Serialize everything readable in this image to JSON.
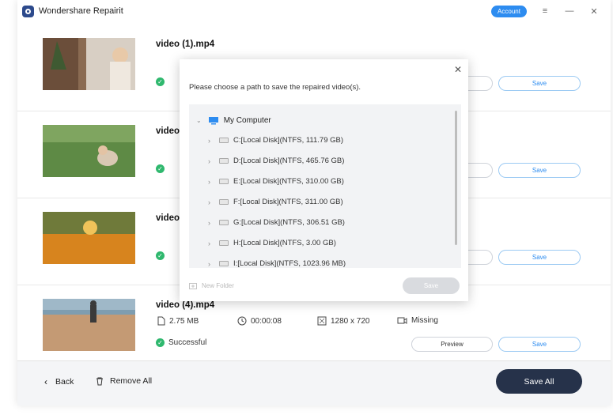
{
  "app": {
    "title": "Wondershare Repairit",
    "account_label": "Account"
  },
  "window_controls": {
    "menu": "≡",
    "minimize": "—",
    "close": "✕"
  },
  "videos": [
    {
      "name": "video (1).mp4",
      "size": "",
      "duration": "",
      "resolution": "",
      "audio": "",
      "status": "",
      "preview_label": "Preview",
      "save_label": "Save"
    },
    {
      "name": "video (2).mp4",
      "size": "",
      "duration": "",
      "resolution": "",
      "audio": "",
      "status": "",
      "preview_label": "Preview",
      "save_label": "Save"
    },
    {
      "name": "video (3).mp4",
      "size": "",
      "duration": "",
      "resolution": "",
      "audio": "",
      "status": "",
      "preview_label": "Preview",
      "save_label": "Save"
    },
    {
      "name": "video (4).mp4",
      "size": "2.75  MB",
      "duration": "00:00:08",
      "resolution": "1280 x 720",
      "audio": "Missing",
      "status": "Successful",
      "preview_label": "Preview",
      "save_label": "Save"
    }
  ],
  "footer": {
    "back_label": "Back",
    "remove_all_label": "Remove All",
    "save_all_label": "Save All"
  },
  "dialog": {
    "message": "Please choose a path to save the repaired video(s).",
    "root_label": "My Computer",
    "disks": [
      "C:[Local Disk](NTFS, 111.79  GB)",
      "D:[Local Disk](NTFS, 465.76  GB)",
      "E:[Local Disk](NTFS, 310.00  GB)",
      "F:[Local Disk](NTFS, 311.00  GB)",
      "G:[Local Disk](NTFS, 306.51  GB)",
      "H:[Local Disk](NTFS, 3.00  GB)",
      "I:[Local Disk](NTFS, 1023.96  MB)"
    ],
    "new_folder_label": "New Folder",
    "save_label": "Save"
  },
  "colors": {
    "accent": "#2d8cf0",
    "success": "#2fb86e",
    "save_all_bg": "#26324a"
  }
}
